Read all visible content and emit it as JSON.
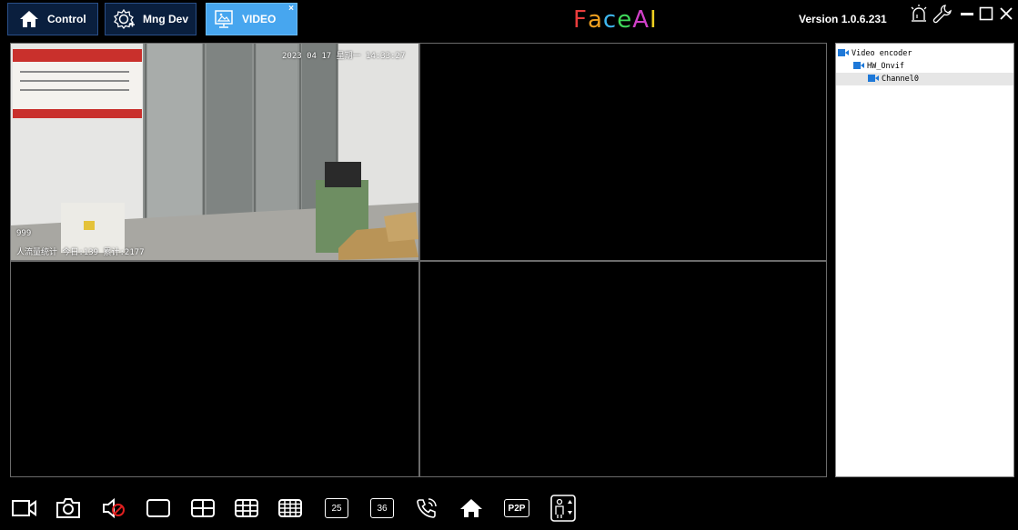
{
  "tabs": [
    {
      "label": "Control",
      "icon": "home-icon"
    },
    {
      "label": "Mng Dev",
      "icon": "gear-add-icon"
    },
    {
      "label": "VIDEO",
      "icon": "video-monitor-icon",
      "close": "×",
      "active": true
    }
  ],
  "brand": {
    "letters": [
      "F",
      "a",
      "c",
      "e",
      "A",
      "I"
    ],
    "colors": [
      "#e83c3c",
      "#f0a020",
      "#3fb8f0",
      "#3fd85a",
      "#d040c8",
      "#f0d020"
    ]
  },
  "version": "Version 1.0.6.231",
  "window_controls": [
    "alarm-icon",
    "wrench-icon",
    "minimize-icon",
    "maximize-icon",
    "close-icon"
  ],
  "video": {
    "timestamp": "2023 04 17 星期一 14:33:27",
    "counter_left": "999",
    "overlay_caption": "人流量统计 今日:139 累计:2177"
  },
  "tree": {
    "items": [
      {
        "label": "Video encoder",
        "level": 0
      },
      {
        "label": "HW_Onvif",
        "level": 1
      },
      {
        "label": "Channel0",
        "level": 2,
        "selected": true
      }
    ]
  },
  "toolbar": {
    "items": [
      "record-icon",
      "snapshot-icon",
      "mute-icon",
      "layout-1-icon",
      "layout-4-icon",
      "layout-9-icon",
      "layout-16-icon",
      "layout-25",
      "layout-36",
      "intercom-icon",
      "home-icon",
      "p2p",
      "people-counter-icon"
    ],
    "layout_25_label": "25",
    "layout_36_label": "36",
    "p2p_label": "P2P"
  },
  "colors": {
    "active_tab": "#47a6ef",
    "tab_bg": "#0a1f3e",
    "cam_icon": "#1e78d8"
  }
}
